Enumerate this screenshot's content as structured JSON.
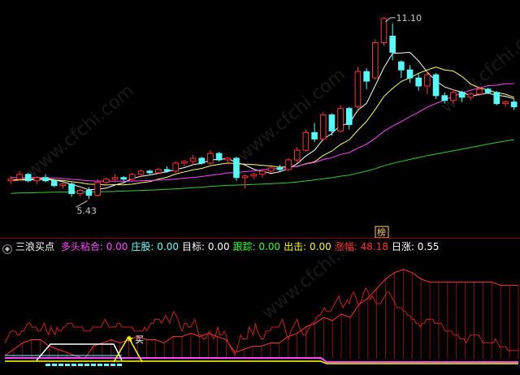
{
  "colors": {
    "up": "#ff3333",
    "down": "#54fcfc",
    "ma5": "#ffffff",
    "ma10": "#ffff66",
    "ma20": "#ff44ff",
    "ma60": "#33cc33",
    "hline": "#ff3333",
    "zhuanggu": "#66ffff",
    "target": "#ffffff",
    "track": "#33ff33",
    "exit": "#ffff00",
    "rise": "#ff3333",
    "daily": "#ffffff",
    "marker_box": "#ffcc66"
  },
  "indicator": {
    "name": "三浪买点",
    "items": [
      {
        "label": "多头粘合",
        "value": "0.00",
        "color": "#ff44ff"
      },
      {
        "label": "庄股",
        "value": "0.00",
        "color": "#66ffff"
      },
      {
        "label": "目标",
        "value": "0.00",
        "color": "#ffffff"
      },
      {
        "label": "跟踪",
        "value": "0.00",
        "color": "#33ff33"
      },
      {
        "label": "出击",
        "value": "0.00",
        "color": "#ffff00"
      },
      {
        "label": "涨幅",
        "value": "48.18",
        "color": "#ff3333"
      },
      {
        "label": "日涨",
        "value": "0.55",
        "color": "#ffffff"
      }
    ],
    "buy_label": "买"
  },
  "marker_label": "榜",
  "watermarks": [
    "www.cfchi.com",
    "www.cfchi.com",
    "www.cfchi.com"
  ],
  "chart_data": [
    {
      "type": "candlestick",
      "high_label": "11.10",
      "low_label": "5.43",
      "ylim": [
        4.3,
        11.5
      ],
      "candles": [
        [
          6.0,
          6.15,
          5.9,
          6.05
        ],
        [
          6.05,
          6.3,
          6.0,
          6.2
        ],
        [
          6.2,
          6.25,
          5.95,
          6.0
        ],
        [
          6.0,
          6.15,
          5.9,
          6.1
        ],
        [
          6.1,
          6.2,
          5.95,
          6.0
        ],
        [
          6.0,
          6.05,
          5.8,
          5.85
        ],
        [
          5.85,
          5.95,
          5.75,
          5.9
        ],
        [
          5.9,
          5.95,
          5.5,
          5.6
        ],
        [
          5.6,
          5.75,
          5.5,
          5.7
        ],
        [
          5.7,
          5.8,
          5.43,
          5.55
        ],
        [
          5.55,
          6.05,
          5.5,
          5.95
        ],
        [
          5.95,
          6.1,
          5.9,
          6.05
        ],
        [
          6.05,
          6.2,
          5.95,
          6.1
        ],
        [
          6.1,
          6.15,
          6.0,
          6.05
        ],
        [
          6.05,
          6.25,
          6.0,
          6.2
        ],
        [
          6.2,
          6.35,
          6.1,
          6.3
        ],
        [
          6.3,
          6.35,
          6.2,
          6.25
        ],
        [
          6.25,
          6.4,
          6.2,
          6.35
        ],
        [
          6.35,
          6.45,
          6.25,
          6.3
        ],
        [
          6.3,
          6.6,
          6.25,
          6.55
        ],
        [
          6.55,
          6.65,
          6.45,
          6.6
        ],
        [
          6.6,
          6.8,
          6.5,
          6.7
        ],
        [
          6.7,
          6.75,
          6.5,
          6.55
        ],
        [
          6.55,
          6.95,
          6.5,
          6.85
        ],
        [
          6.85,
          6.9,
          6.6,
          6.65
        ],
        [
          6.65,
          6.75,
          6.5,
          6.7
        ],
        [
          6.7,
          6.75,
          6.0,
          6.1
        ],
        [
          6.1,
          6.2,
          5.75,
          6.15
        ],
        [
          6.15,
          6.25,
          6.05,
          6.2
        ],
        [
          6.2,
          6.35,
          6.1,
          6.3
        ],
        [
          6.3,
          6.45,
          6.25,
          6.4
        ],
        [
          6.4,
          6.5,
          6.3,
          6.35
        ],
        [
          6.35,
          6.7,
          6.3,
          6.65
        ],
        [
          6.65,
          7.05,
          6.55,
          6.95
        ],
        [
          6.95,
          7.6,
          6.9,
          7.5
        ],
        [
          7.5,
          7.8,
          7.2,
          7.3
        ],
        [
          7.3,
          8.15,
          7.25,
          8.05
        ],
        [
          8.05,
          8.1,
          7.4,
          7.55
        ],
        [
          7.55,
          8.35,
          7.5,
          8.25
        ],
        [
          8.25,
          8.3,
          7.6,
          7.75
        ],
        [
          8.3,
          9.55,
          8.25,
          9.4
        ],
        [
          9.4,
          9.5,
          8.85,
          9.1
        ],
        [
          9.2,
          10.4,
          9.15,
          10.3
        ],
        [
          10.3,
          11.1,
          10.2,
          11.05
        ],
        [
          10.5,
          10.9,
          9.75,
          10.0
        ],
        [
          9.7,
          9.75,
          9.2,
          9.45
        ],
        [
          9.45,
          9.6,
          9.05,
          9.2
        ],
        [
          9.2,
          9.35,
          8.8,
          8.95
        ],
        [
          8.95,
          9.4,
          8.7,
          9.3
        ],
        [
          9.3,
          9.35,
          8.55,
          8.65
        ],
        [
          8.65,
          8.75,
          8.4,
          8.5
        ],
        [
          8.5,
          8.85,
          8.4,
          8.75
        ],
        [
          8.75,
          8.8,
          8.45,
          8.6
        ],
        [
          8.6,
          8.75,
          8.5,
          8.7
        ],
        [
          8.7,
          8.9,
          8.65,
          8.85
        ],
        [
          8.85,
          8.9,
          8.7,
          8.75
        ],
        [
          8.75,
          8.8,
          8.35,
          8.4
        ],
        [
          8.4,
          8.5,
          8.3,
          8.45
        ],
        [
          8.45,
          8.55,
          8.2,
          8.3
        ]
      ]
    },
    {
      "type": "line",
      "series": [
        {
          "values": [
            4.2,
            4.3,
            4.4,
            4.5,
            4.5,
            4.5,
            4.4,
            4.4,
            4.5,
            4.5,
            4.6,
            4.7,
            4.7,
            4.6,
            4.6,
            4.6,
            4.5,
            4.5,
            4.6,
            4.7,
            4.5,
            4.4,
            4.6,
            4.5,
            4.4,
            4.6,
            4.5,
            4.5,
            4.6,
            4.6,
            4.7,
            4.7,
            4.7,
            4.6,
            4.6,
            4.6,
            4.6,
            4.6,
            4.5,
            4.5,
            4.5,
            4.5,
            4.6,
            4.6,
            4.6,
            4.6,
            4.6,
            4.7,
            4.8,
            4.7,
            4.6,
            4.6,
            4.6,
            4.6,
            4.7,
            4.7,
            4.6,
            4.6,
            4.6,
            4.6,
            4.6,
            4.6,
            4.5,
            4.5,
            4.5,
            4.5,
            4.5,
            4.6,
            4.5,
            4.6,
            4.7,
            4.7,
            4.8,
            4.8,
            4.8,
            4.7,
            4.8,
            4.9,
            4.8,
            4.7,
            4.9,
            5.0,
            4.9,
            4.8,
            4.6,
            4.5,
            4.7,
            4.7,
            4.6,
            4.6,
            4.7,
            4.8,
            4.6,
            4.4,
            4.4,
            4.3,
            4.3,
            4.4,
            4.5,
            4.4,
            4.3,
            4.4,
            4.6,
            4.4,
            4.4,
            4.5,
            4.4,
            4.2,
            4.1,
            4.0,
            3.9,
            4.0,
            4.2,
            4.4,
            4.3,
            4.3,
            4.3,
            4.6,
            4.5,
            4.4,
            4.7,
            4.5,
            4.4,
            4.3,
            4.3,
            4.5,
            4.5,
            4.5,
            4.6,
            4.6,
            4.6,
            4.6,
            4.7,
            4.8,
            4.6,
            4.4,
            4.3,
            4.5,
            4.6,
            4.7,
            4.8,
            4.6,
            4.5,
            4.4,
            4.4,
            4.5,
            4.6,
            4.7,
            4.7,
            4.8,
            4.9,
            4.9,
            5.0,
            5.1,
            5.0,
            5.0,
            5.0,
            5.1,
            5.2,
            5.3,
            5.4,
            5.2,
            5.1,
            5.2,
            5.3,
            5.2,
            5.4,
            5.5,
            5.4,
            5.2,
            5.2,
            5.3,
            5.5,
            5.6,
            5.5,
            5.3,
            5.4,
            5.3,
            5.2,
            5.2,
            5.2,
            5.3,
            5.4,
            5.5,
            5.5,
            5.4,
            5.3,
            5.2,
            5.1,
            5.1,
            5.1,
            5.0,
            5.0,
            4.9,
            4.9,
            4.8,
            4.8,
            4.7,
            4.7,
            4.6,
            4.7,
            4.7,
            4.8,
            4.8,
            4.8,
            4.8,
            4.7,
            4.7,
            4.7,
            4.7,
            4.6,
            4.5,
            4.5,
            4.5,
            4.5,
            4.4,
            4.4,
            4.4,
            4.3,
            4.3,
            4.3,
            4.2,
            4.3,
            4.4,
            4.4,
            4.4,
            4.4,
            4.4,
            4.3,
            4.2,
            4.2,
            4.2,
            4.2,
            4.2,
            4.2,
            4.3,
            4.2,
            4.1,
            4.1,
            4.1,
            4.1,
            4.0,
            4.0,
            4.0,
            4.0,
            4.0,
            4.0
          ]
        }
      ]
    }
  ]
}
